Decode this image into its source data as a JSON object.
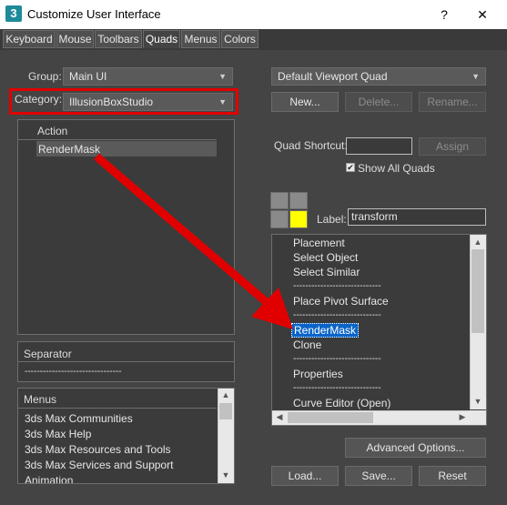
{
  "window": {
    "title": "Customize User Interface",
    "icon_text": "3",
    "help_label": "?",
    "close_label": "✕"
  },
  "tabs": [
    "Keyboard",
    "Mouse",
    "Toolbars",
    "Quads",
    "Menus",
    "Colors"
  ],
  "active_tab": "Quads",
  "left": {
    "group_label": "Group:",
    "group_value": "Main UI",
    "category_label": "Category:",
    "category_value": "IllusionBoxStudio",
    "action_header": "Action",
    "actions": [
      "RenderMask"
    ],
    "separator_header": "Separator",
    "separator_item": "--------------------------------",
    "menus_header": "Menus",
    "menus": [
      "3ds Max Communities",
      "3ds Max Help",
      "3ds Max Resources and Tools",
      "3ds Max Services and Support",
      "Animation"
    ]
  },
  "right": {
    "quad_dropdown": "Default Viewport Quad",
    "new_label": "New...",
    "delete_label": "Delete...",
    "rename_label": "Rename...",
    "shortcut_label": "Quad Shortcut:",
    "shortcut_value": "",
    "assign_label": "Assign",
    "show_all_label": "Show All Quads",
    "show_all_checked": "✔",
    "label_label": "Label:",
    "label_value": "transform",
    "quad_items": [
      "Placement",
      "Select Object",
      "Select Similar",
      "-----------------------------",
      "Place Pivot Surface",
      "-----------------------------",
      "RenderMask",
      "Clone",
      "-----------------------------",
      "Properties",
      "-----------------------------",
      "Curve Editor (Open)"
    ],
    "selected_item": "RenderMask",
    "advanced_label": "Advanced Options...",
    "load_label": "Load...",
    "save_label": "Save...",
    "reset_label": "Reset"
  },
  "colors": {
    "annotation": "#e00000",
    "quad_highlight": "#ffff00",
    "selection": "#0a64c8"
  },
  "icons": [
    "dropdown-arrow-icon",
    "checkbox-check-icon",
    "scroll-up-icon",
    "scroll-down-icon",
    "scroll-left-icon",
    "scroll-right-icon",
    "annotation-arrow-icon"
  ]
}
